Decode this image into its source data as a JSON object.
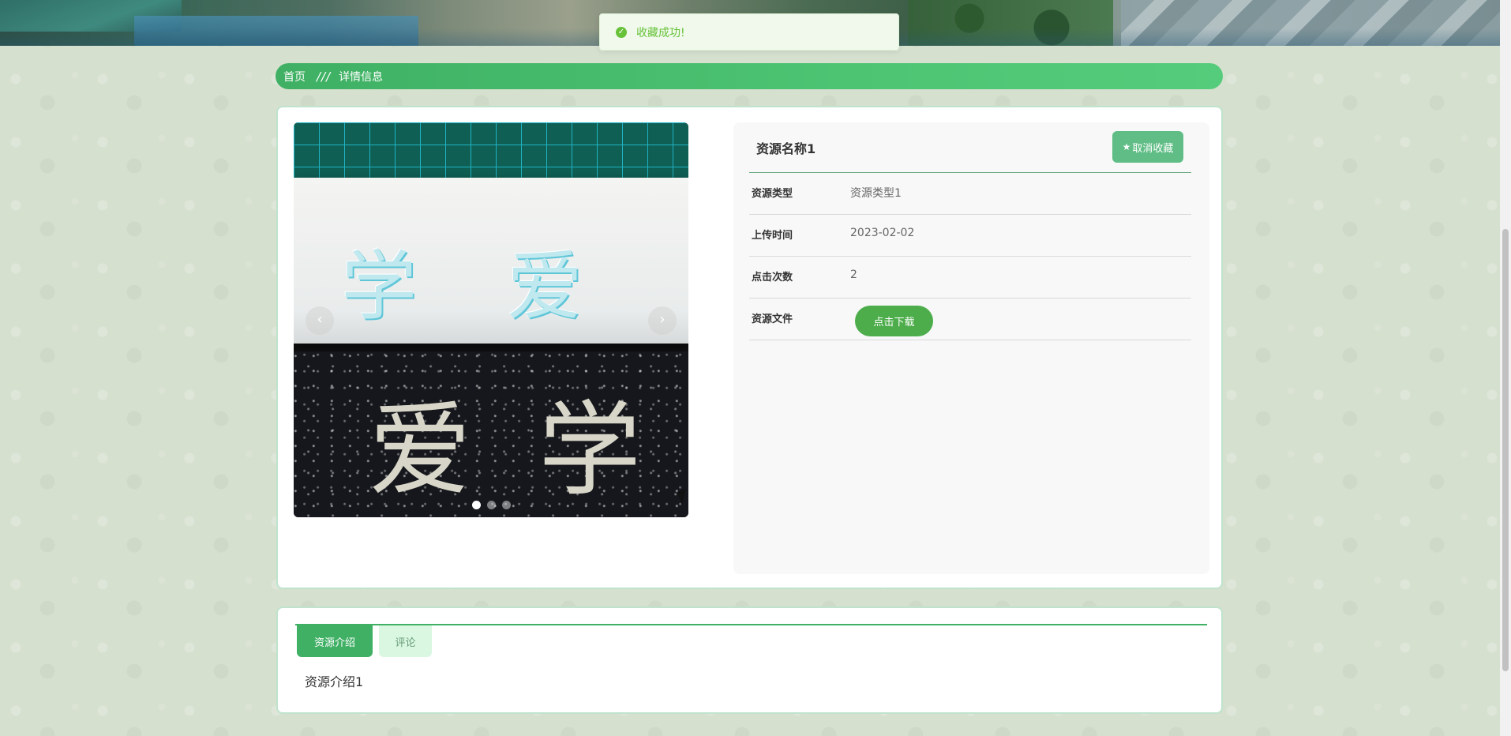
{
  "toast": {
    "icon": "check-circle-icon",
    "message": "收藏成功!"
  },
  "breadcrumb": {
    "home": "首页",
    "separator": "///",
    "current": "详情信息"
  },
  "carousel": {
    "prev_glyph": "‹",
    "next_glyph": "›",
    "slide_count": 3,
    "active_index": 0,
    "image_chars_top": [
      "学",
      "爱"
    ],
    "image_chars_bottom": [
      "爱",
      "学"
    ]
  },
  "detail": {
    "title": "资源名称1",
    "collect_button": "★取消收藏",
    "collect_star": "★",
    "collect_label": "取消收藏",
    "rows": [
      {
        "label": "资源类型",
        "value": "资源类型1"
      },
      {
        "label": "上传时间",
        "value": "2023-02-02"
      },
      {
        "label": "点击次数",
        "value": "2"
      },
      {
        "label": "资源文件",
        "value": ""
      }
    ],
    "download_button": "点击下载"
  },
  "tabs": {
    "items": [
      {
        "label": "资源介绍",
        "active": true
      },
      {
        "label": "评论",
        "active": false
      }
    ],
    "content": "资源介绍1"
  },
  "colors": {
    "accent": "#3fb064",
    "toast_text": "#67c23a",
    "toast_bg": "#f0f9eb",
    "download": "#4dad4b",
    "collect": "#5fbd85"
  }
}
